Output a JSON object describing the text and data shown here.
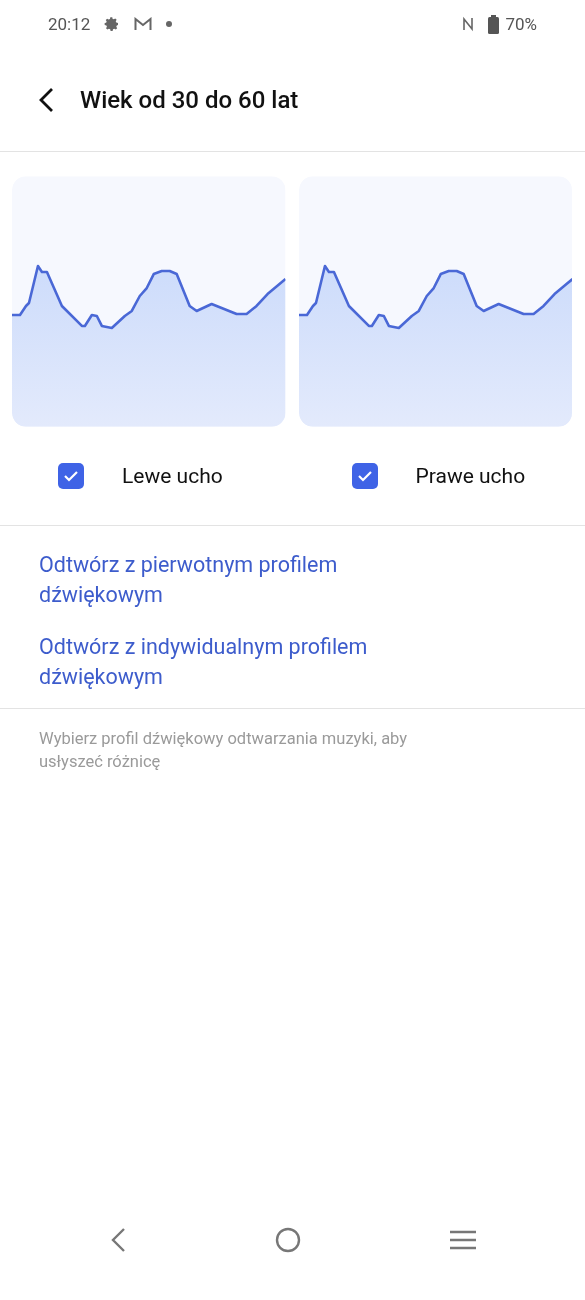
{
  "status_bar": {
    "time": "20:12",
    "battery": "70%"
  },
  "header": {
    "title": "Wiek od 30 do 60 lat"
  },
  "ears": [
    {
      "label": "Lewe ucho",
      "checked": true
    },
    {
      "label": "Prawe ucho",
      "checked": true
    }
  ],
  "options": [
    "Odtwórz z pierwotnym profilem dźwiękowym",
    "Odtwórz z indywidualnym profilem dźwiękowym"
  ],
  "hint": "Wybierz profil dźwiękowy odtwarzania muzyki, aby usłyszeć różnicę"
}
